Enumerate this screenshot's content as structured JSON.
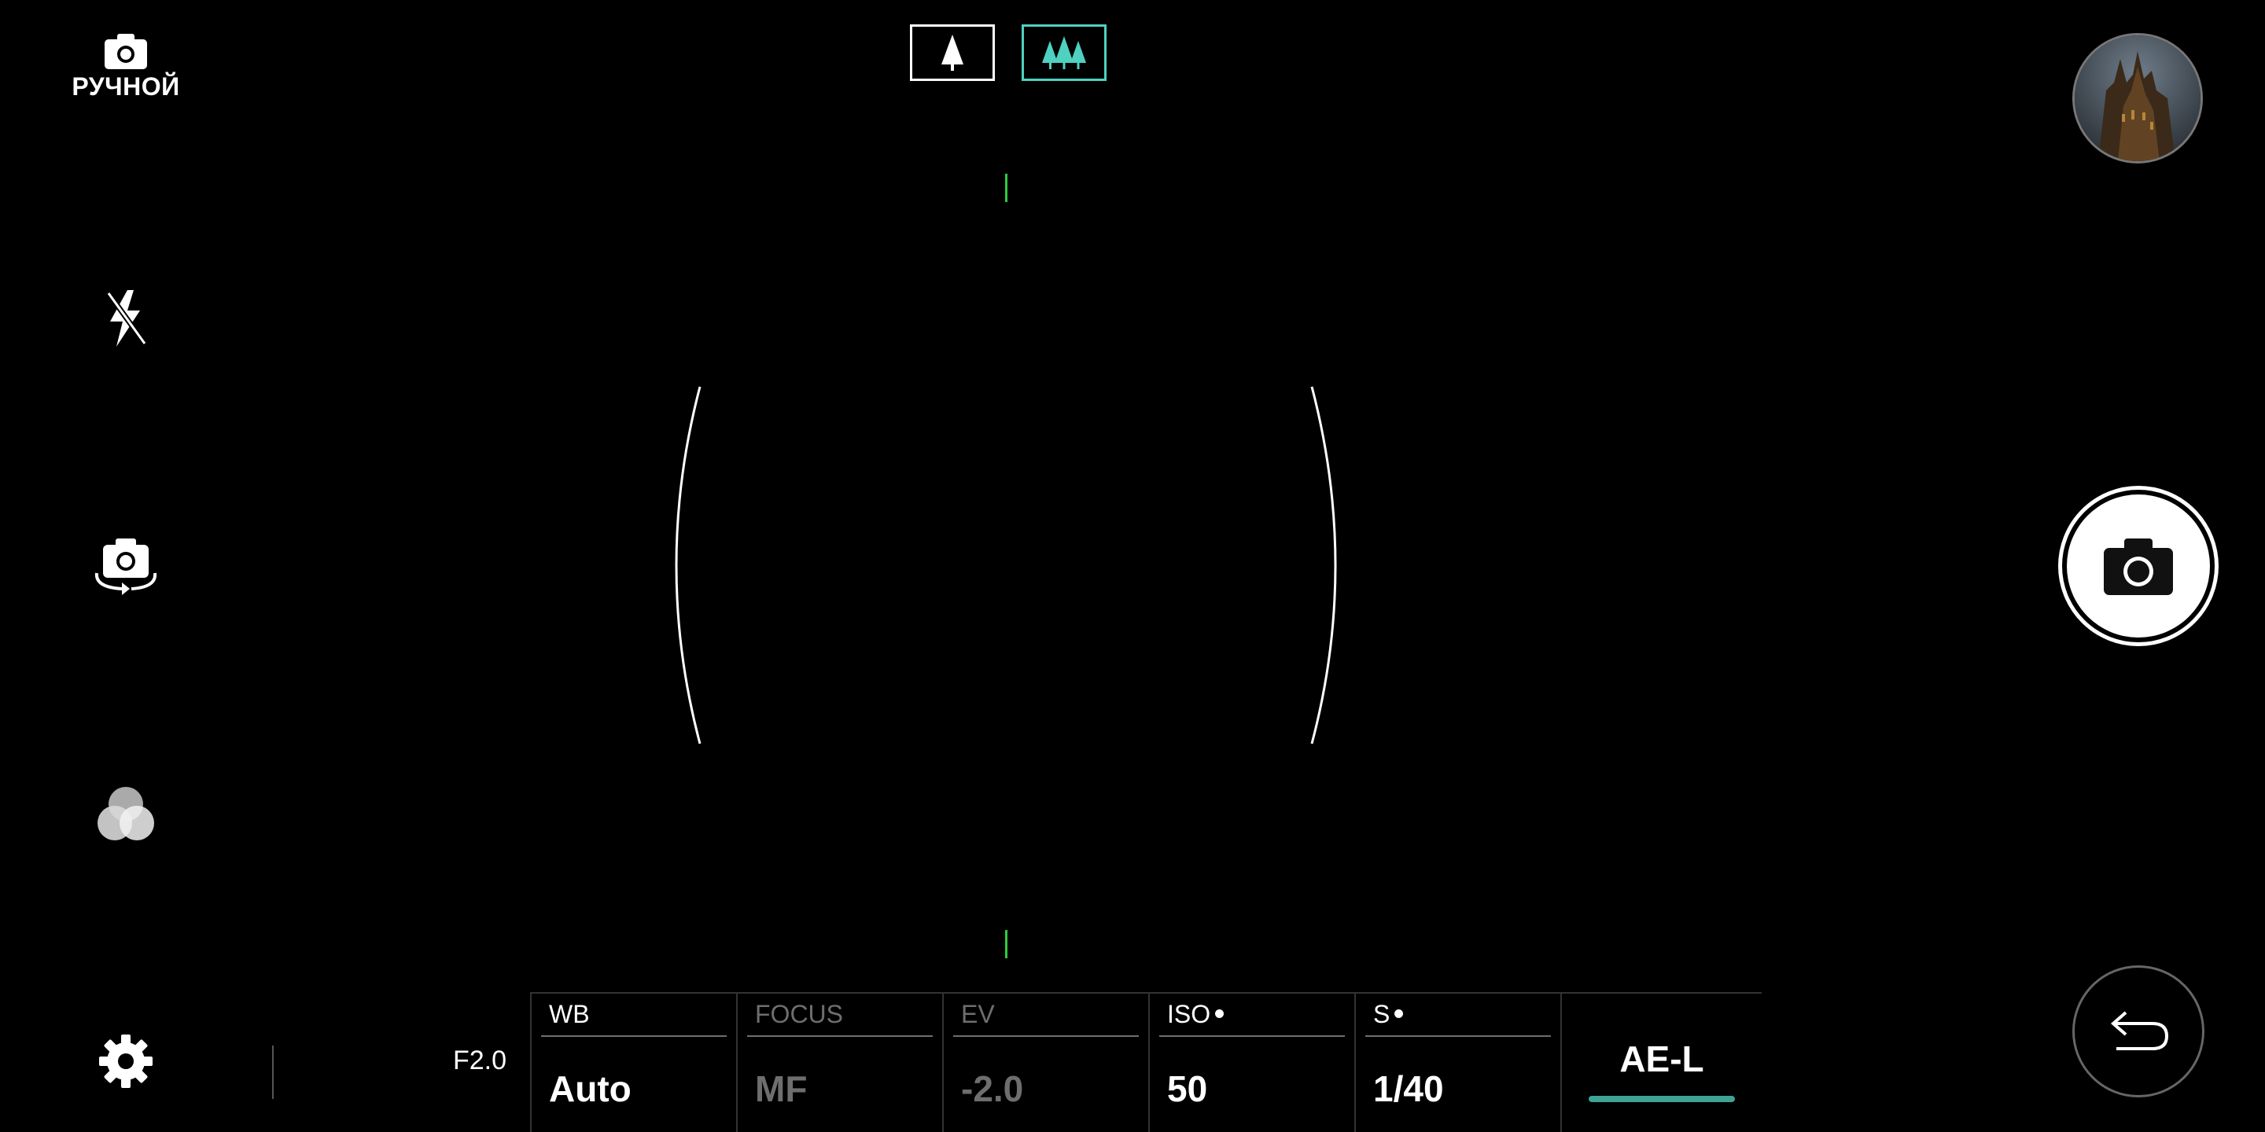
{
  "mode": {
    "label": "РУЧНОЙ",
    "icon": "camera-icon"
  },
  "left_rail": {
    "flash_icon": "flash-off-icon",
    "switch_icon": "camera-switch-icon",
    "filter_icon": "color-filter-icon",
    "settings_icon": "gear-icon"
  },
  "lens": {
    "standard_icon": "single-tree-icon",
    "wide_icon": "three-trees-icon",
    "active": "wide",
    "active_color": "#4fd1c1"
  },
  "aperture": "F2.0",
  "controls": [
    {
      "label": "WB",
      "value": "Auto",
      "enabled": true,
      "dot": false
    },
    {
      "label": "FOCUS",
      "value": "MF",
      "enabled": false,
      "dot": false
    },
    {
      "label": "EV",
      "value": "-2.0",
      "enabled": false,
      "dot": false
    },
    {
      "label": "ISO",
      "value": "50",
      "enabled": true,
      "dot": true
    },
    {
      "label": "S",
      "value": "1/40",
      "enabled": true,
      "dot": true
    }
  ],
  "ae_lock": {
    "label": "AE-L",
    "accent": "#3fa394"
  },
  "right_rail": {
    "gallery_icon": "gallery-thumbnail",
    "shutter_icon": "camera-icon",
    "back_icon": "back-arrow-icon"
  }
}
